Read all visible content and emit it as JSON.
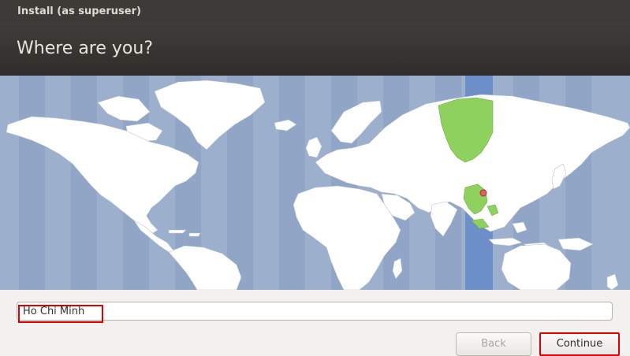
{
  "window": {
    "title": "Install (as superuser)"
  },
  "header": {
    "heading": "Where are you?"
  },
  "map": {
    "selected_city": "Ho Chi Minh",
    "colors": {
      "ocean": "#9cb0cd",
      "ocean_band_dark": "#8ea4c4",
      "land": "#ffffff",
      "selected_zone_band": "#6c8fc7",
      "selected_zone_land": "#8fd15f",
      "marker": "#e06060"
    }
  },
  "location": {
    "value": "Ho Chi Minh"
  },
  "buttons": {
    "back": "Back",
    "continue": "Continue"
  }
}
